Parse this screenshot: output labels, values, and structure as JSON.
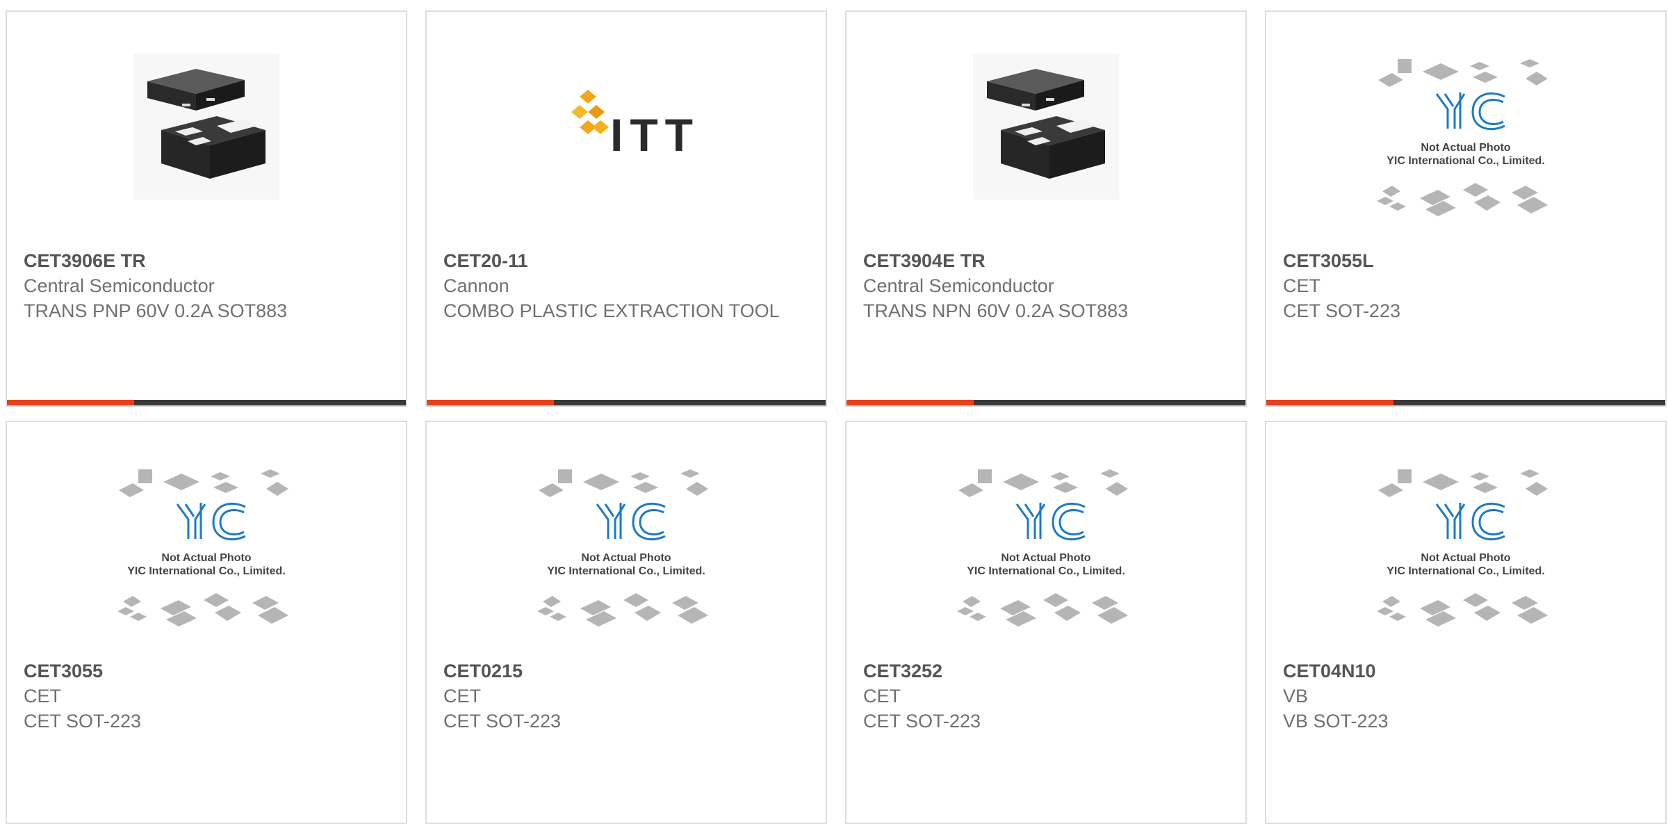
{
  "accent_color": "#e8401c",
  "bar_color": "#3a3a3a",
  "products": [
    {
      "part_number": "CET3906E TR",
      "manufacturer": "Central Semiconductor",
      "description": "TRANS PNP 60V 0.2A SOT883",
      "image": "sot883-package-photo"
    },
    {
      "part_number": "CET20-11",
      "manufacturer": "Cannon",
      "description": "COMBO PLASTIC EXTRACTION TOOL",
      "image": "itt-logo",
      "logo_text": "ITT"
    },
    {
      "part_number": "CET3904E TR",
      "manufacturer": "Central Semiconductor",
      "description": "TRANS NPN 60V 0.2A SOT883",
      "image": "sot883-package-photo"
    },
    {
      "part_number": "CET3055L",
      "manufacturer": "CET",
      "description": "CET SOT-223",
      "image": "yic-placeholder"
    },
    {
      "part_number": "CET3055",
      "manufacturer": "CET",
      "description": "CET SOT-223",
      "image": "yic-placeholder"
    },
    {
      "part_number": "CET0215",
      "manufacturer": "CET",
      "description": "CET SOT-223",
      "image": "yic-placeholder"
    },
    {
      "part_number": "CET3252",
      "manufacturer": "CET",
      "description": "CET SOT-223",
      "image": "yic-placeholder"
    },
    {
      "part_number": "CET04N10",
      "manufacturer": "VB",
      "description": "VB SOT-223",
      "image": "yic-placeholder"
    }
  ],
  "placeholder": {
    "logo_text": "YIC",
    "line1": "Not Actual Photo",
    "line2": "YIC International Co., Limited."
  }
}
